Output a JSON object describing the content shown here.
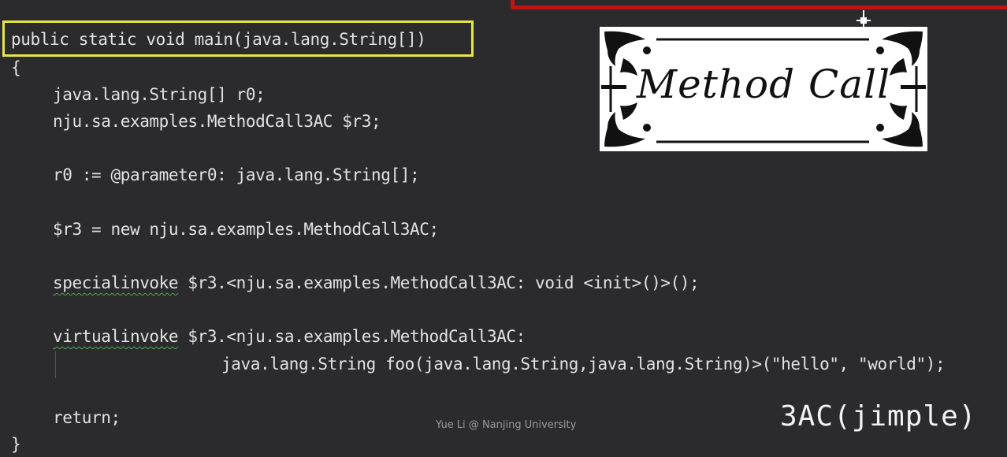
{
  "code": {
    "signature": "public static void main(java.lang.String[])",
    "open_brace": "{",
    "decl1": "java.lang.String[] r0;",
    "decl2": "nju.sa.examples.MethodCall3AC $r3;",
    "param_assign": "r0 := @parameter0: java.lang.String[];",
    "new_stmt": "$r3 = new nju.sa.examples.MethodCall3AC;",
    "special_keyword": "specialinvoke",
    "special_rest": " $r3.<nju.sa.examples.MethodCall3AC: void <init>()>();",
    "virtual_keyword": "virtualinvoke",
    "virtual_rest": " $r3.<nju.sa.examples.MethodCall3AC:",
    "virtual_cont": "java.lang.String foo(java.lang.String,java.lang.String)>(\"hello\", \"world\");",
    "return_stmt": "return;",
    "close_brace": "}"
  },
  "card": {
    "title": "Method Call"
  },
  "label": "3AC(jimple)",
  "watermark": "Yue Li @ Nanjing University",
  "colors": {
    "background": "#2b2b2d",
    "highlight": "#e6e54a",
    "red_bar": "#c11414",
    "squiggle": "#4fa84f"
  }
}
